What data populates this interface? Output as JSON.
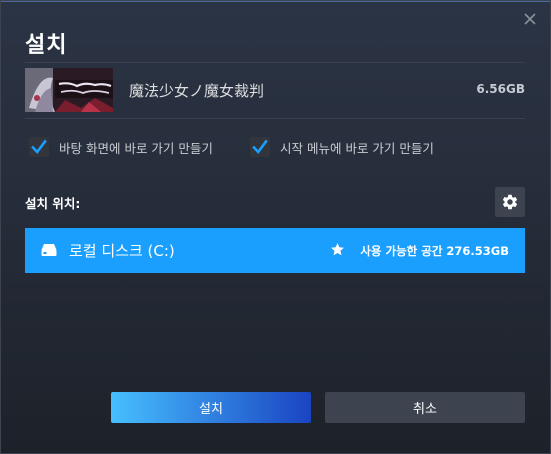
{
  "dialog": {
    "title": "설치"
  },
  "game": {
    "name": "魔法少女ノ魔女裁判",
    "size": "6.56GB",
    "thumbnail_icon": "game-thumbnail"
  },
  "options": [
    {
      "label": "바탕 화면에 바로 가기 만들기",
      "checked": true
    },
    {
      "label": "시작 메뉴에 바로 가기 만들기",
      "checked": true
    }
  ],
  "location": {
    "label": "설치 위치:",
    "settings_icon": "gear-icon",
    "drive": {
      "name": "로컬 디스크 (C:)",
      "free_space": "사용 가능한 공간 276.53GB",
      "icon": "drive-icon",
      "default_icon": "star-icon"
    }
  },
  "buttons": {
    "install": "설치",
    "cancel": "취소"
  },
  "colors": {
    "accent": "#1a9fff",
    "checkbox_check": "#1a9fff",
    "button_secondary": "#3d4450"
  }
}
